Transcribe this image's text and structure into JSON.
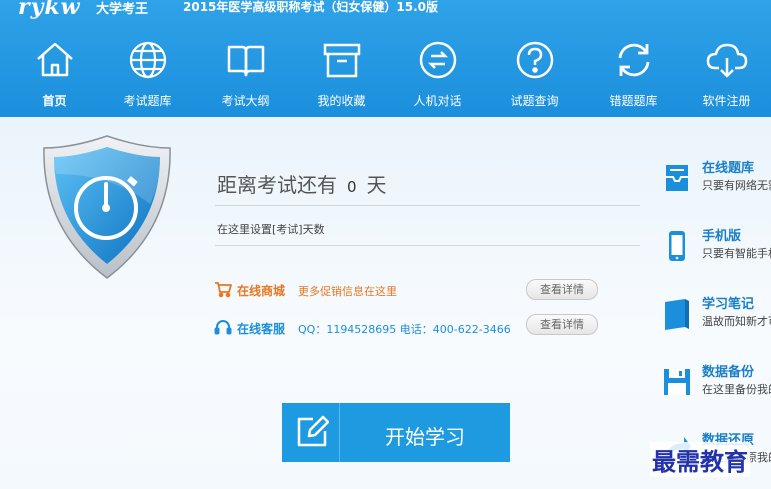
{
  "header": {
    "logo": "rykw",
    "logo_sub": "大学考王",
    "app_title": "2015年医学高级职称考试（妇女保健）15.0版"
  },
  "nav": [
    {
      "label": "首页",
      "icon": "home-icon"
    },
    {
      "label": "考试题库",
      "icon": "globe-icon"
    },
    {
      "label": "考试大纲",
      "icon": "book-icon"
    },
    {
      "label": "我的收藏",
      "icon": "box-icon"
    },
    {
      "label": "人机对话",
      "icon": "dialog-icon"
    },
    {
      "label": "试题查询",
      "icon": "question-icon"
    },
    {
      "label": "错题题库",
      "icon": "refresh-icon"
    },
    {
      "label": "软件注册",
      "icon": "cloud-download-icon"
    }
  ],
  "countdown": {
    "prefix": "距离考试还有",
    "days": "0",
    "suffix": "天",
    "set_link": "在这里设置[考试]天数"
  },
  "mall": {
    "label": "在线商城",
    "desc": "更多促销信息在这里",
    "button": "查看详情"
  },
  "service": {
    "label": "在线客服",
    "desc": "QQ：1194528695 电话：400-622-3466",
    "button": "查看详情"
  },
  "start_button": "开始学习",
  "side": [
    {
      "title": "在线题库",
      "desc": "只要有网络无需"
    },
    {
      "title": "手机版",
      "desc": "只要有智能手机"
    },
    {
      "title": "学习笔记",
      "desc": "温故而知新才可"
    },
    {
      "title": "数据备份",
      "desc": "在这里备份我的"
    },
    {
      "title": "数据还原",
      "desc": "在这里还原我的"
    }
  ],
  "watermark": "最需教育",
  "colors": {
    "header_blue": "#1b8fdc",
    "accent_orange": "#e87722",
    "start_button": "#1e9be0"
  }
}
